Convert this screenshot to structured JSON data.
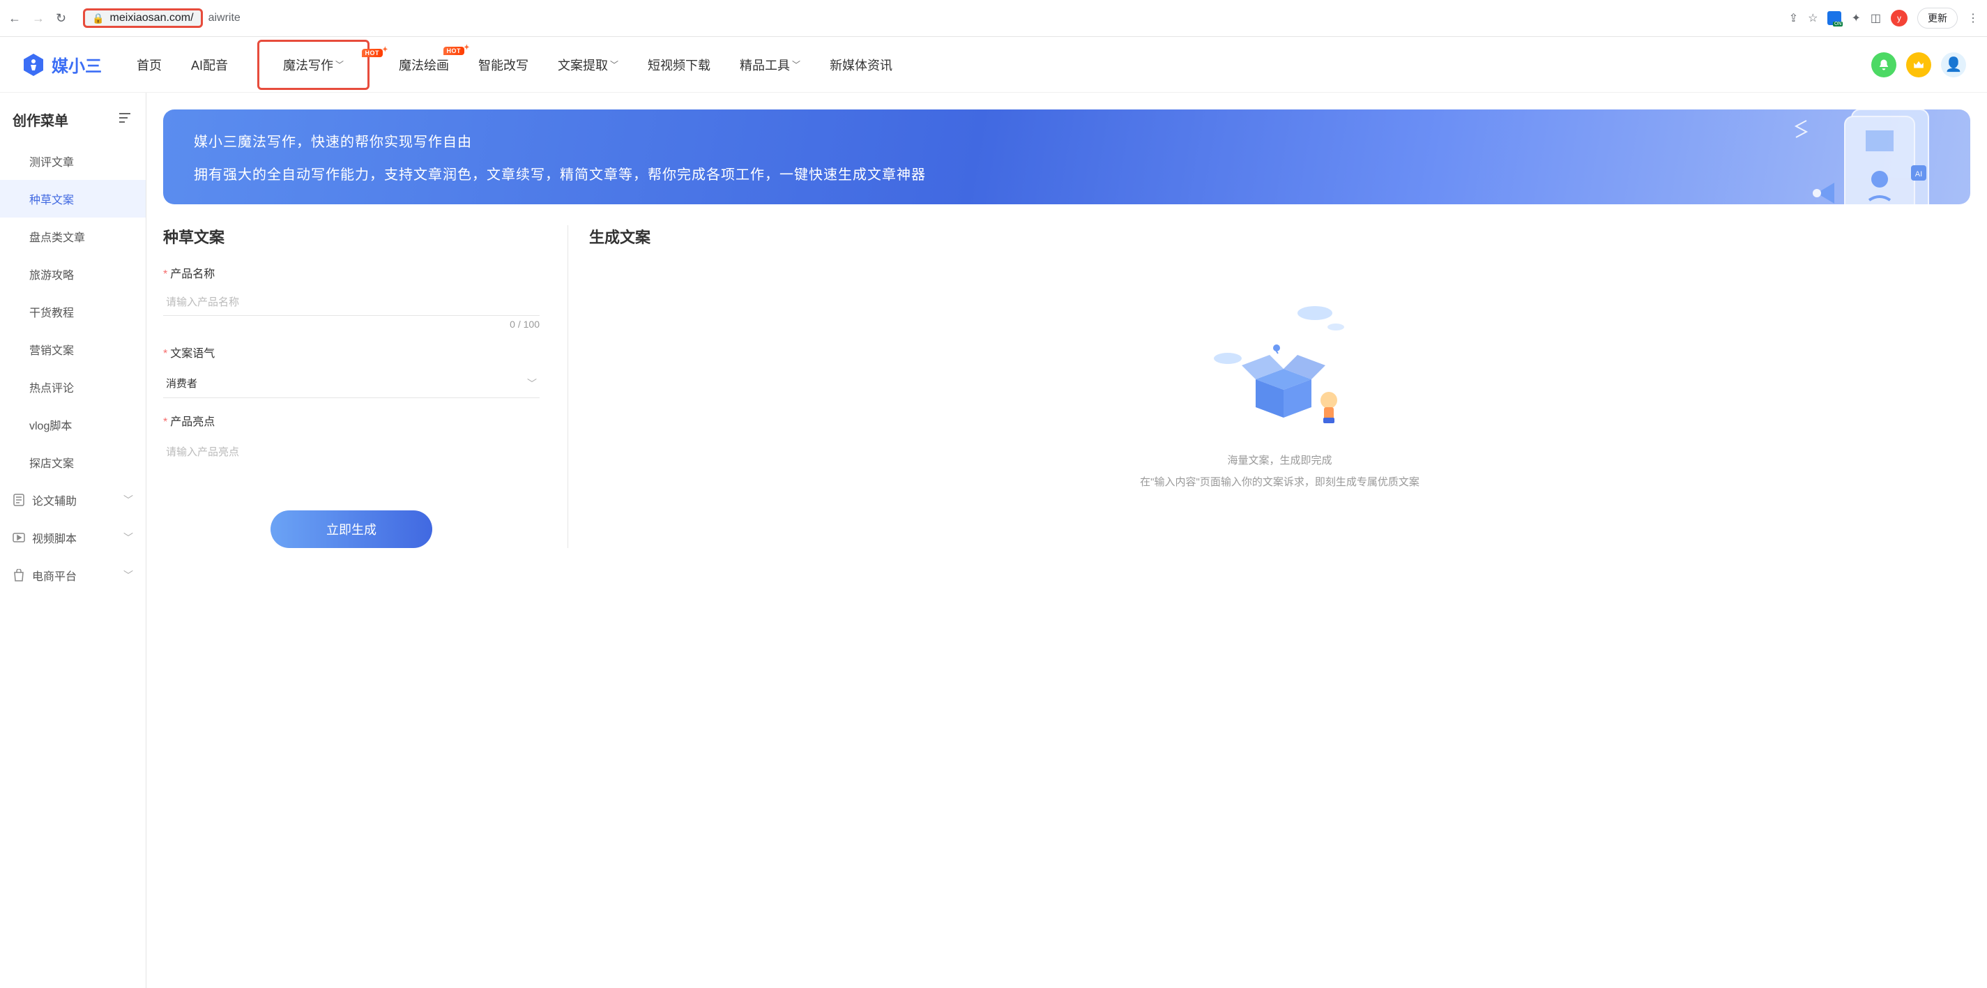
{
  "browser": {
    "url_domain": "meixiaosan.com/",
    "url_path": "aiwrite",
    "update_label": "更新",
    "avatar_letter": "y"
  },
  "header": {
    "brand": "媒小三",
    "nav": [
      {
        "label": "首页",
        "dropdown": false,
        "hot": false
      },
      {
        "label": "AI配音",
        "dropdown": false,
        "hot": false
      },
      {
        "label": "魔法写作",
        "dropdown": true,
        "hot": true,
        "highlighted": true
      },
      {
        "label": "魔法绘画",
        "dropdown": false,
        "hot": true
      },
      {
        "label": "智能改写",
        "dropdown": false,
        "hot": false
      },
      {
        "label": "文案提取",
        "dropdown": true,
        "hot": false
      },
      {
        "label": "短视频下载",
        "dropdown": false,
        "hot": false
      },
      {
        "label": "精品工具",
        "dropdown": true,
        "hot": false
      },
      {
        "label": "新媒体资讯",
        "dropdown": false,
        "hot": false
      }
    ],
    "hot_label": "HOT"
  },
  "sidebar": {
    "title": "创作菜单",
    "items": [
      {
        "label": "测评文章",
        "active": false
      },
      {
        "label": "种草文案",
        "active": true
      },
      {
        "label": "盘点类文章",
        "active": false
      },
      {
        "label": "旅游攻略",
        "active": false
      },
      {
        "label": "干货教程",
        "active": false
      },
      {
        "label": "营销文案",
        "active": false
      },
      {
        "label": "热点评论",
        "active": false
      },
      {
        "label": "vlog脚本",
        "active": false
      },
      {
        "label": "探店文案",
        "active": false
      }
    ],
    "groups": [
      {
        "label": "论文辅助",
        "icon": "doc"
      },
      {
        "label": "视频脚本",
        "icon": "video"
      },
      {
        "label": "电商平台",
        "icon": "bag"
      }
    ]
  },
  "banner": {
    "line1": "媒小三魔法写作，快速的帮你实现写作自由",
    "line2": "拥有强大的全自动写作能力，支持文章润色，文章续写，精简文章等，帮你完成各项工作，一键快速生成文章神器"
  },
  "form": {
    "title": "种草文案",
    "product_name_label": "产品名称",
    "product_name_placeholder": "请输入产品名称",
    "product_name_counter": "0 / 100",
    "tone_label": "文案语气",
    "tone_value": "消费者",
    "highlight_label": "产品亮点",
    "highlight_placeholder": "请输入产品亮点",
    "submit_label": "立即生成"
  },
  "output": {
    "title": "生成文案",
    "placeholder_line1": "海量文案，生成即完成",
    "placeholder_line2": "在\"输入内容\"页面输入你的文案诉求，即刻生成专属优质文案"
  }
}
